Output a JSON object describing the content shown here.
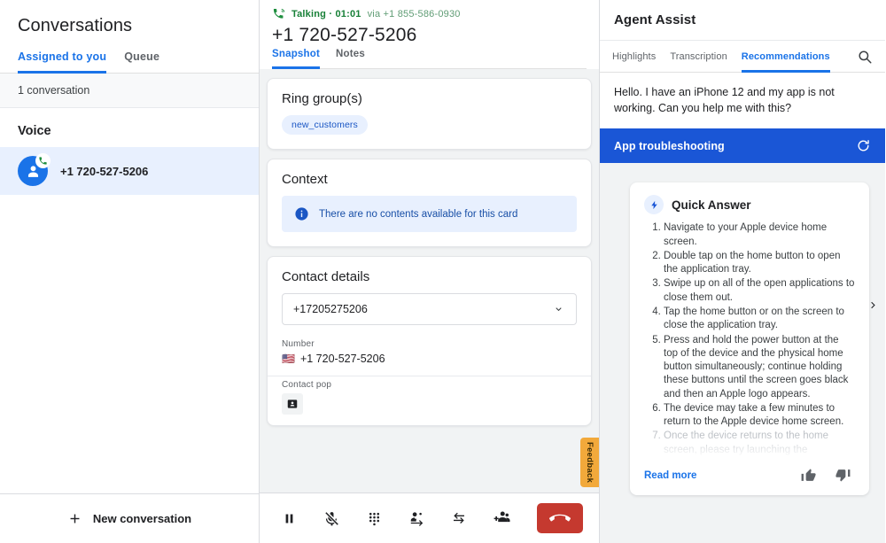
{
  "conversations": {
    "title": "Conversations",
    "tabs": [
      {
        "label": "Assigned to you",
        "active": true
      },
      {
        "label": "Queue",
        "active": false
      }
    ],
    "count_text": "1 conversation",
    "section_label": "Voice",
    "items": [
      {
        "number": "+1 720-527-5206"
      }
    ],
    "new_conversation_label": "New conversation"
  },
  "call": {
    "status_label": "Talking · 01:01",
    "via_label": "via +1 855-586-0930",
    "phone_number": "+1 720-527-5206",
    "tabs": [
      {
        "label": "Snapshot",
        "active": true
      },
      {
        "label": "Notes",
        "active": false
      }
    ],
    "ring_group": {
      "title": "Ring group(s)",
      "chips": [
        "new_customers"
      ]
    },
    "context": {
      "title": "Context",
      "empty_message": "There are no contents available for this card"
    },
    "contact_details": {
      "title": "Contact details",
      "selected_contact": "+17205275206",
      "number_label": "Number",
      "number_value": "+1 720-527-5206",
      "number_flag": "🇺🇸",
      "contact_pop_label": "Contact pop"
    },
    "feedback_label": "Feedback",
    "controls": [
      {
        "name": "hold-button",
        "icon": "pause-icon"
      },
      {
        "name": "mute-button",
        "icon": "mic-off-icon"
      },
      {
        "name": "dialpad-button",
        "icon": "dialpad-icon"
      },
      {
        "name": "transfer-button",
        "icon": "person-transfer-icon"
      },
      {
        "name": "swap-call-button",
        "icon": "swap-arrows-icon"
      },
      {
        "name": "add-participant-button",
        "icon": "person-add-icon"
      }
    ],
    "hangup_label": "End call"
  },
  "agent_assist": {
    "title": "Agent Assist",
    "tabs": [
      {
        "label": "Highlights",
        "active": false
      },
      {
        "label": "Transcription",
        "active": false
      },
      {
        "label": "Recommendations",
        "active": true
      }
    ],
    "customer_message": "Hello. I have an iPhone 12 and my app is not working. Can you help me with this?",
    "topic_label": "App troubleshooting",
    "quick_answer": {
      "title": "Quick Answer",
      "steps": [
        "Navigate to your Apple device home screen.",
        "Double tap on the home button to open the application tray.",
        "Swipe up on all of the open applications to close them out.",
        "Tap the home button or on the screen to close the application tray.",
        "Press and hold the power button at the top of the device and the physical home button simultaneously; continue holding these buttons until the screen goes black and then an Apple logo appears.",
        "The device may take a few minutes to return to the Apple device home screen.",
        "Once the device returns to the home screen, please try launching the"
      ],
      "read_more_label": "Read more"
    }
  },
  "colors": {
    "accent_blue": "#1a73e8",
    "topic_blue": "#1a56d6",
    "status_green": "#188038",
    "hangup_red": "#c5392f",
    "feedback_orange": "#f2a93b",
    "selected_row": "#e8f0fe"
  }
}
